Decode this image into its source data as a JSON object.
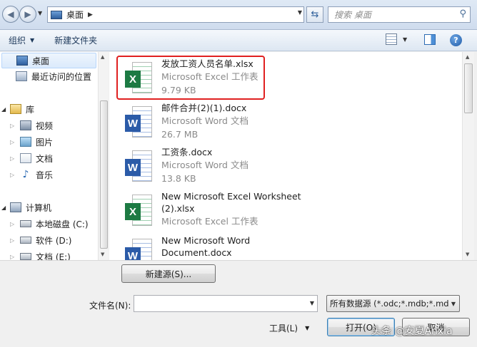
{
  "address_bar": {
    "location": "桌面",
    "search_placeholder": "搜索 桌面"
  },
  "toolbar": {
    "organize_label": "组织",
    "new_folder_label": "新建文件夹"
  },
  "nav": {
    "items": [
      {
        "label": "桌面",
        "icon": "desktop-icon"
      },
      {
        "label": "最近访问的位置",
        "icon": "recent-places-icon"
      },
      {
        "label": "库",
        "icon": "library-icon"
      },
      {
        "label": "视频",
        "icon": "videos-icon"
      },
      {
        "label": "图片",
        "icon": "pictures-icon"
      },
      {
        "label": "文档",
        "icon": "documents-icon"
      },
      {
        "label": "音乐",
        "icon": "music-icon"
      },
      {
        "label": "计算机",
        "icon": "computer-icon"
      },
      {
        "label": "本地磁盘 (C:)",
        "icon": "drive-icon"
      },
      {
        "label": "软件 (D:)",
        "icon": "drive-icon"
      },
      {
        "label": "文档 (E:)",
        "icon": "drive-icon"
      }
    ]
  },
  "files": [
    {
      "name": "发放工资人员名单.xlsx",
      "type": "Microsoft Excel 工作表",
      "size": "9.79 KB",
      "icon": "excel-icon"
    },
    {
      "name": "邮件合并(2)(1).docx",
      "type": "Microsoft Word 文档",
      "size": "26.7 MB",
      "icon": "word-icon"
    },
    {
      "name": "工资条.docx",
      "type": "Microsoft Word 文档",
      "size": "13.8 KB",
      "icon": "word-icon"
    },
    {
      "name": "New Microsoft Excel Worksheet",
      "name2": "(2).xlsx",
      "type": "Microsoft Excel 工作表",
      "icon": "excel-icon"
    },
    {
      "name": "New Microsoft Word",
      "name2": "Document.docx",
      "icon": "word-icon"
    }
  ],
  "bottom": {
    "new_source_label": "新建源(S)...",
    "filename_label": "文件名(N):",
    "filename_value": "",
    "filter_value": "所有数据源 (*.odc;*.mdb;*.md",
    "tools_label": "工具(L)",
    "open_label": "打开(O)",
    "cancel_label": "取消"
  },
  "watermark": "头条 @安夏Anxia",
  "colors": {
    "highlight_border": "#e02020",
    "excel_green": "#1d7a43",
    "word_blue": "#2b5ba8"
  }
}
